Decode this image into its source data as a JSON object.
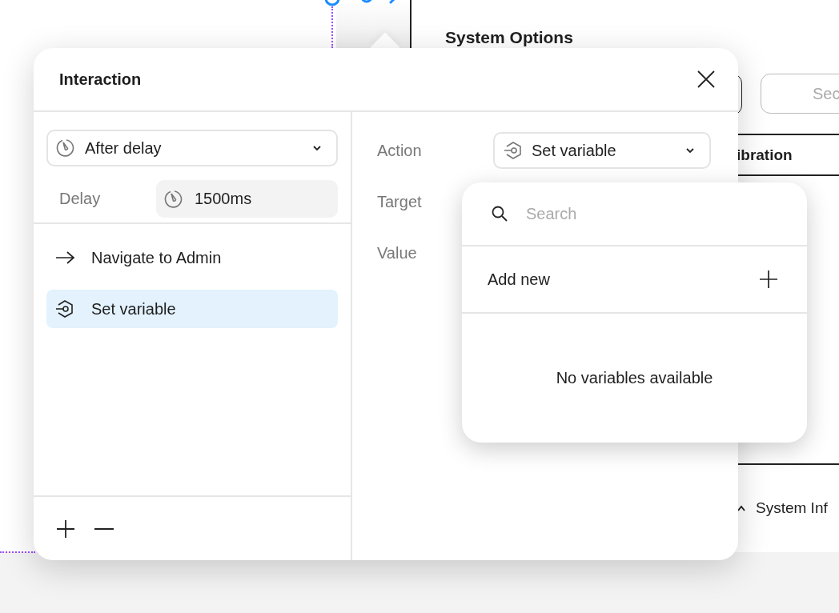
{
  "canvas": {
    "heading": "System Options",
    "button": "Sec",
    "tab": "ibration",
    "section": "System Inf"
  },
  "dialog": {
    "title": "Interaction",
    "trigger": {
      "value": "After delay"
    },
    "delay": {
      "label": "Delay",
      "value": "1500ms"
    },
    "actions": [
      {
        "label": "Navigate to Admin",
        "kind": "navigate",
        "selected": false
      },
      {
        "label": "Set variable",
        "kind": "variable",
        "selected": true
      }
    ],
    "fields": [
      {
        "label": "Action",
        "value": "Set variable"
      },
      {
        "label": "Target"
      },
      {
        "label": "Value"
      }
    ]
  },
  "dropdown": {
    "placeholder": "Search",
    "add_label": "Add new",
    "empty_text": "No variables available"
  }
}
